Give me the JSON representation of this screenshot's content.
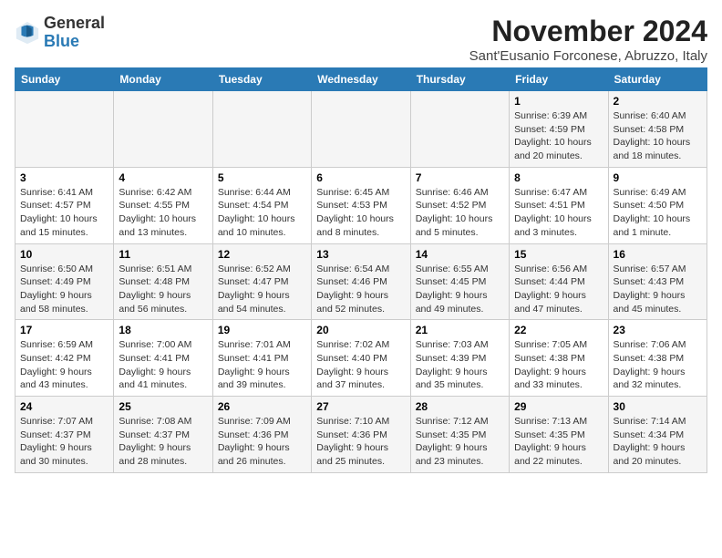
{
  "header": {
    "logo_general": "General",
    "logo_blue": "Blue",
    "month_title": "November 2024",
    "location": "Sant'Eusanio Forconese, Abruzzo, Italy"
  },
  "weekdays": [
    "Sunday",
    "Monday",
    "Tuesday",
    "Wednesday",
    "Thursday",
    "Friday",
    "Saturday"
  ],
  "weeks": [
    [
      {
        "day": "",
        "info": ""
      },
      {
        "day": "",
        "info": ""
      },
      {
        "day": "",
        "info": ""
      },
      {
        "day": "",
        "info": ""
      },
      {
        "day": "",
        "info": ""
      },
      {
        "day": "1",
        "info": "Sunrise: 6:39 AM\nSunset: 4:59 PM\nDaylight: 10 hours and 20 minutes."
      },
      {
        "day": "2",
        "info": "Sunrise: 6:40 AM\nSunset: 4:58 PM\nDaylight: 10 hours and 18 minutes."
      }
    ],
    [
      {
        "day": "3",
        "info": "Sunrise: 6:41 AM\nSunset: 4:57 PM\nDaylight: 10 hours and 15 minutes."
      },
      {
        "day": "4",
        "info": "Sunrise: 6:42 AM\nSunset: 4:55 PM\nDaylight: 10 hours and 13 minutes."
      },
      {
        "day": "5",
        "info": "Sunrise: 6:44 AM\nSunset: 4:54 PM\nDaylight: 10 hours and 10 minutes."
      },
      {
        "day": "6",
        "info": "Sunrise: 6:45 AM\nSunset: 4:53 PM\nDaylight: 10 hours and 8 minutes."
      },
      {
        "day": "7",
        "info": "Sunrise: 6:46 AM\nSunset: 4:52 PM\nDaylight: 10 hours and 5 minutes."
      },
      {
        "day": "8",
        "info": "Sunrise: 6:47 AM\nSunset: 4:51 PM\nDaylight: 10 hours and 3 minutes."
      },
      {
        "day": "9",
        "info": "Sunrise: 6:49 AM\nSunset: 4:50 PM\nDaylight: 10 hours and 1 minute."
      }
    ],
    [
      {
        "day": "10",
        "info": "Sunrise: 6:50 AM\nSunset: 4:49 PM\nDaylight: 9 hours and 58 minutes."
      },
      {
        "day": "11",
        "info": "Sunrise: 6:51 AM\nSunset: 4:48 PM\nDaylight: 9 hours and 56 minutes."
      },
      {
        "day": "12",
        "info": "Sunrise: 6:52 AM\nSunset: 4:47 PM\nDaylight: 9 hours and 54 minutes."
      },
      {
        "day": "13",
        "info": "Sunrise: 6:54 AM\nSunset: 4:46 PM\nDaylight: 9 hours and 52 minutes."
      },
      {
        "day": "14",
        "info": "Sunrise: 6:55 AM\nSunset: 4:45 PM\nDaylight: 9 hours and 49 minutes."
      },
      {
        "day": "15",
        "info": "Sunrise: 6:56 AM\nSunset: 4:44 PM\nDaylight: 9 hours and 47 minutes."
      },
      {
        "day": "16",
        "info": "Sunrise: 6:57 AM\nSunset: 4:43 PM\nDaylight: 9 hours and 45 minutes."
      }
    ],
    [
      {
        "day": "17",
        "info": "Sunrise: 6:59 AM\nSunset: 4:42 PM\nDaylight: 9 hours and 43 minutes."
      },
      {
        "day": "18",
        "info": "Sunrise: 7:00 AM\nSunset: 4:41 PM\nDaylight: 9 hours and 41 minutes."
      },
      {
        "day": "19",
        "info": "Sunrise: 7:01 AM\nSunset: 4:41 PM\nDaylight: 9 hours and 39 minutes."
      },
      {
        "day": "20",
        "info": "Sunrise: 7:02 AM\nSunset: 4:40 PM\nDaylight: 9 hours and 37 minutes."
      },
      {
        "day": "21",
        "info": "Sunrise: 7:03 AM\nSunset: 4:39 PM\nDaylight: 9 hours and 35 minutes."
      },
      {
        "day": "22",
        "info": "Sunrise: 7:05 AM\nSunset: 4:38 PM\nDaylight: 9 hours and 33 minutes."
      },
      {
        "day": "23",
        "info": "Sunrise: 7:06 AM\nSunset: 4:38 PM\nDaylight: 9 hours and 32 minutes."
      }
    ],
    [
      {
        "day": "24",
        "info": "Sunrise: 7:07 AM\nSunset: 4:37 PM\nDaylight: 9 hours and 30 minutes."
      },
      {
        "day": "25",
        "info": "Sunrise: 7:08 AM\nSunset: 4:37 PM\nDaylight: 9 hours and 28 minutes."
      },
      {
        "day": "26",
        "info": "Sunrise: 7:09 AM\nSunset: 4:36 PM\nDaylight: 9 hours and 26 minutes."
      },
      {
        "day": "27",
        "info": "Sunrise: 7:10 AM\nSunset: 4:36 PM\nDaylight: 9 hours and 25 minutes."
      },
      {
        "day": "28",
        "info": "Sunrise: 7:12 AM\nSunset: 4:35 PM\nDaylight: 9 hours and 23 minutes."
      },
      {
        "day": "29",
        "info": "Sunrise: 7:13 AM\nSunset: 4:35 PM\nDaylight: 9 hours and 22 minutes."
      },
      {
        "day": "30",
        "info": "Sunrise: 7:14 AM\nSunset: 4:34 PM\nDaylight: 9 hours and 20 minutes."
      }
    ]
  ]
}
